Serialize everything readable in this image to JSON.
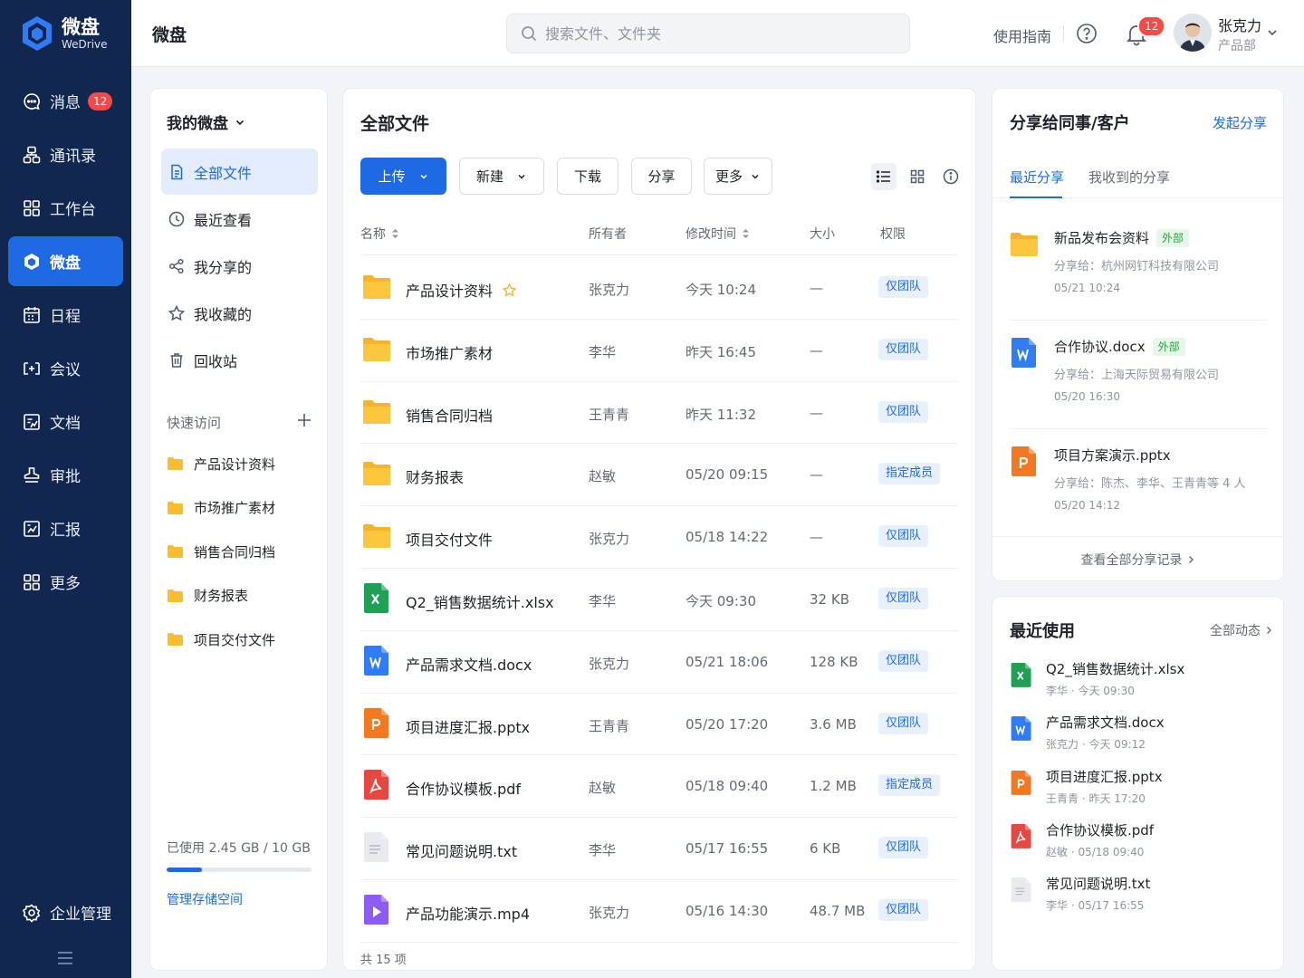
{
  "brand": {
    "name": "微盘",
    "sub": "WeDrive",
    "primary": "#1e6ae5",
    "nav_bg": "#122750"
  },
  "nav": {
    "items": [
      {
        "label": "消息",
        "icon": "message-icon",
        "badge": "12"
      },
      {
        "label": "通讯录",
        "icon": "contacts-icon"
      },
      {
        "label": "工作台",
        "icon": "workbench-icon"
      },
      {
        "label": "微盘",
        "icon": "drive-icon",
        "active": true
      },
      {
        "label": "日程",
        "icon": "calendar-icon"
      },
      {
        "label": "会议",
        "icon": "meeting-icon"
      },
      {
        "label": "文档",
        "icon": "document-icon"
      },
      {
        "label": "审批",
        "icon": "approval-icon"
      },
      {
        "label": "汇报",
        "icon": "report-icon"
      },
      {
        "label": "更多",
        "icon": "more-apps-icon"
      }
    ],
    "bottom": {
      "label": "企业管理",
      "icon": "settings-icon"
    }
  },
  "header": {
    "title": "微盘",
    "search_placeholder": "搜索文件、文件夹",
    "guide": "使用指南",
    "notification_count": "12",
    "user": {
      "name": "张克力",
      "dept": "产品部"
    }
  },
  "sidebar": {
    "title": "我的微盘",
    "items": [
      {
        "label": "全部文件",
        "icon": "file-list-icon",
        "active": true
      },
      {
        "label": "最近查看",
        "icon": "clock-icon"
      },
      {
        "label": "我分享的",
        "icon": "share-icon"
      },
      {
        "label": "我收藏的",
        "icon": "star-icon"
      },
      {
        "label": "回收站",
        "icon": "trash-icon"
      }
    ],
    "quick_title": "快速访问",
    "quick": [
      "产品设计资料",
      "市场推广素材",
      "销售合同归档",
      "财务报表",
      "项目交付文件"
    ],
    "storage": {
      "text": "已使用 2.45 GB / 10 GB",
      "used_fraction": 0.245,
      "manage": "管理存储空间"
    }
  },
  "main": {
    "title": "全部文件",
    "toolbar": {
      "upload": "上传",
      "new": "新建",
      "download": "下载",
      "share": "分享",
      "more": "更多"
    },
    "columns": {
      "name": "名称",
      "owner": "所有者",
      "modified": "修改时间",
      "size": "大小",
      "permission": "权限"
    },
    "files": [
      {
        "name": "产品设计资料",
        "type": "folder",
        "starred": true,
        "owner": "张克力",
        "modified": "今天 10:24",
        "size": "—",
        "perm": "仅团队"
      },
      {
        "name": "市场推广素材",
        "type": "folder",
        "owner": "李华",
        "modified": "昨天 16:45",
        "size": "—",
        "perm": "仅团队"
      },
      {
        "name": "销售合同归档",
        "type": "folder",
        "owner": "王青青",
        "modified": "昨天 11:32",
        "size": "—",
        "perm": "仅团队"
      },
      {
        "name": "财务报表",
        "type": "folder",
        "owner": "赵敏",
        "modified": "05/20 09:15",
        "size": "—",
        "perm": "指定成员"
      },
      {
        "name": "项目交付文件",
        "type": "folder",
        "owner": "张克力",
        "modified": "05/18 14:22",
        "size": "—",
        "perm": "仅团队"
      },
      {
        "name": "Q2_销售数据统计.xlsx",
        "type": "xlsx",
        "owner": "李华",
        "modified": "今天 09:30",
        "size": "32 KB",
        "perm": "仅团队"
      },
      {
        "name": "产品需求文档.docx",
        "type": "docx",
        "owner": "张克力",
        "modified": "05/21 18:06",
        "size": "128 KB",
        "perm": "仅团队"
      },
      {
        "name": "项目进度汇报.pptx",
        "type": "pptx",
        "owner": "王青青",
        "modified": "05/20 17:20",
        "size": "3.6 MB",
        "perm": "仅团队"
      },
      {
        "name": "合作协议模板.pdf",
        "type": "pdf",
        "owner": "赵敏",
        "modified": "05/18 09:40",
        "size": "1.2 MB",
        "perm": "指定成员"
      },
      {
        "name": "常见问题说明.txt",
        "type": "txt",
        "owner": "李华",
        "modified": "05/17 16:55",
        "size": "6 KB",
        "perm": "仅团队"
      },
      {
        "name": "产品功能演示.mp4",
        "type": "mp4",
        "owner": "张克力",
        "modified": "05/16 14:30",
        "size": "48.7 MB",
        "perm": "仅团队"
      }
    ],
    "total": "共 15 项"
  },
  "share": {
    "title": "分享给同事/客户",
    "action": "发起分享",
    "tabs": [
      "最近分享",
      "我收到的分享"
    ],
    "items": [
      {
        "name": "新品发布会资料",
        "type": "folder",
        "tag": "外部",
        "to": "分享给：杭州网钉科技有限公司",
        "date": "05/21 10:24"
      },
      {
        "name": "合作协议.docx",
        "type": "docx",
        "tag": "外部",
        "to": "分享给：上海天际贸易有限公司",
        "date": "05/20 16:30"
      },
      {
        "name": "项目方案演示.pptx",
        "type": "pptx",
        "tag": "",
        "to": "分享给：陈杰、李华、王青青等 4 人",
        "date": "05/20 14:12"
      }
    ],
    "view_all": "查看全部分享记录"
  },
  "recent": {
    "title": "最近使用",
    "more": "全部动态",
    "items": [
      {
        "name": "Q2_销售数据统计.xlsx",
        "type": "xlsx",
        "meta": "李华 · 今天 09:30"
      },
      {
        "name": "产品需求文档.docx",
        "type": "docx",
        "meta": "张克力 · 今天 09:12"
      },
      {
        "name": "项目进度汇报.pptx",
        "type": "pptx",
        "meta": "王青青 · 昨天 17:20"
      },
      {
        "name": "合作协议模板.pdf",
        "type": "pdf",
        "meta": "赵敏 · 05/18 09:40"
      },
      {
        "name": "常见问题说明.txt",
        "type": "txt",
        "meta": "李华 · 05/17 16:55"
      }
    ]
  }
}
